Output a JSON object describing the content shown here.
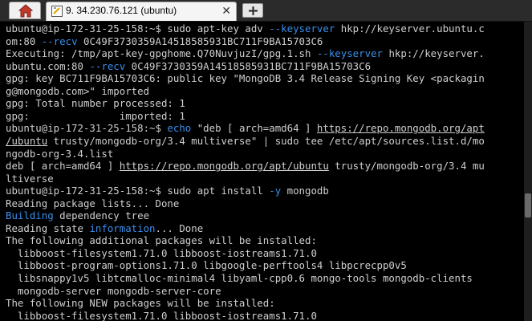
{
  "tabs": {
    "active_title": "9. 34.230.76.121 (ubuntu)",
    "close_glyph": "✕",
    "new_tab_label": "+"
  },
  "colors": {
    "default": "#cfcfcf",
    "blue": "#3b8eea",
    "background": "#000000"
  },
  "terminal": {
    "lines": [
      [
        [
          "ubuntu@ip-172-31-25-158:~$ sudo apt-key adv ",
          "default"
        ],
        [
          "--keyserver",
          "blue"
        ],
        [
          " hkp://keyserver.ubuntu.c",
          "default"
        ]
      ],
      [
        [
          "om:80 ",
          "default"
        ],
        [
          "--recv",
          "blue"
        ],
        [
          " 0C49F3730359A14518585931BC711F9BA15703C6",
          "default"
        ]
      ],
      [
        [
          "Executing: /tmp/apt-key-gpghome.Q70NuvjuzI/gpg.1.sh ",
          "default"
        ],
        [
          "--keyserver",
          "blue"
        ],
        [
          " hkp://keyserver.",
          "default"
        ]
      ],
      [
        [
          "ubuntu.com:80 ",
          "default"
        ],
        [
          "--recv",
          "blue"
        ],
        [
          " 0C49F3730359A14518585931BC711F9BA15703C6",
          "default"
        ]
      ],
      [
        [
          "gpg: key BC711F9BA15703C6: public key \"MongoDB 3.4 Release Signing Key <packagin",
          "default"
        ]
      ],
      [
        [
          "g@mongodb.com>\" imported",
          "default"
        ]
      ],
      [
        [
          "gpg: Total number processed: 1",
          "default"
        ]
      ],
      [
        [
          "gpg:               imported: 1",
          "default"
        ]
      ],
      [
        [
          "ubuntu@ip-172-31-25-158:~$ ",
          "default"
        ],
        [
          "echo",
          "blue"
        ],
        [
          " \"deb [ arch=amd64 ] ",
          "default"
        ],
        [
          "https://repo.mongodb.org/apt",
          "url"
        ]
      ],
      [
        [
          "/ubuntu",
          "url"
        ],
        [
          " trusty/mongodb-org/3.4 multiverse\" | sudo tee /etc/apt/sources.list.d/mo",
          "default"
        ]
      ],
      [
        [
          "ngodb-org-3.4.list",
          "default"
        ]
      ],
      [
        [
          "deb [ arch=amd64 ] ",
          "default"
        ],
        [
          "https://repo.mongodb.org/apt/ubuntu",
          "url"
        ],
        [
          " trusty/mongodb-org/3.4 mu",
          "default"
        ]
      ],
      [
        [
          "ltiverse",
          "default"
        ]
      ],
      [
        [
          "ubuntu@ip-172-31-25-158:~$ sudo apt install ",
          "default"
        ],
        [
          "-y",
          "blue"
        ],
        [
          " mongodb",
          "default"
        ]
      ],
      [
        [
          "Reading package lists... Done",
          "default"
        ]
      ],
      [
        [
          "Building",
          "blue"
        ],
        [
          " dependency tree",
          "default"
        ]
      ],
      [
        [
          "Reading state ",
          "default"
        ],
        [
          "information",
          "blue"
        ],
        [
          "... Done",
          "default"
        ]
      ],
      [
        [
          "The following additional packages will be installed:",
          "default"
        ]
      ],
      [
        [
          "  libboost-filesystem1.71.0 libboost-iostreams1.71.0",
          "default"
        ]
      ],
      [
        [
          "  libboost-program-options1.71.0 libgoogle-perftools4 libpcrecpp0v5",
          "default"
        ]
      ],
      [
        [
          "  libsnappy1v5 libtcmalloc-minimal4 libyaml-cpp0.6 mongo-tools mongodb-clients",
          "default"
        ]
      ],
      [
        [
          "  mongodb-server mongodb-server-core",
          "default"
        ]
      ],
      [
        [
          "The following NEW packages will be installed:",
          "default"
        ]
      ],
      [
        [
          "  libboost-filesystem1.71.0 libboost-iostreams1.71.0",
          "default"
        ]
      ]
    ]
  }
}
